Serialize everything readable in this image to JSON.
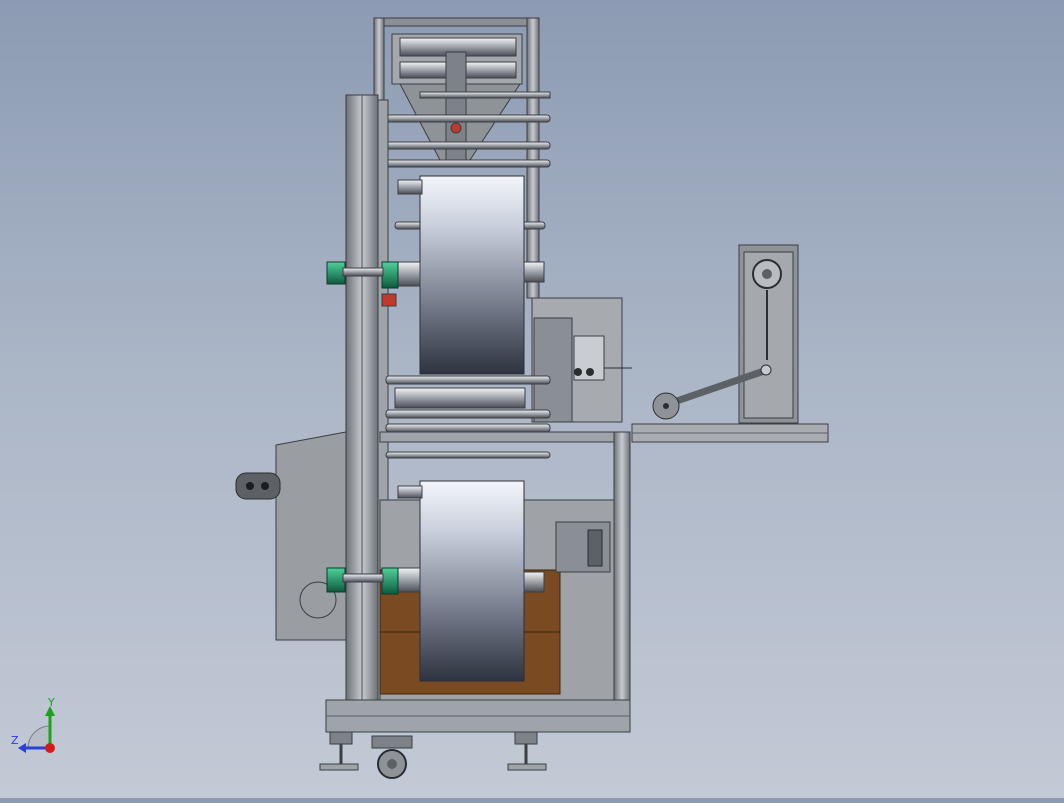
{
  "viewport": {
    "background_top": "#8c9bb3",
    "background_bottom": "#c3cad6"
  },
  "model": {
    "frame_color": "#9ea4aa",
    "frame_dark": "#5c6166",
    "panel_color": "#8f9398",
    "roll_color_light": "#e8ecf4",
    "roll_color_dark": "#3a3f4c",
    "bearing_color": "#1f8a63",
    "wood_color": "#7a4a22",
    "accent_red": "#c0392b"
  },
  "triad": {
    "y_label": "Y",
    "z_label": "Z",
    "y_color": "#1aa31a",
    "z_color": "#2a3fd6",
    "x_color": "#d61a1a"
  }
}
